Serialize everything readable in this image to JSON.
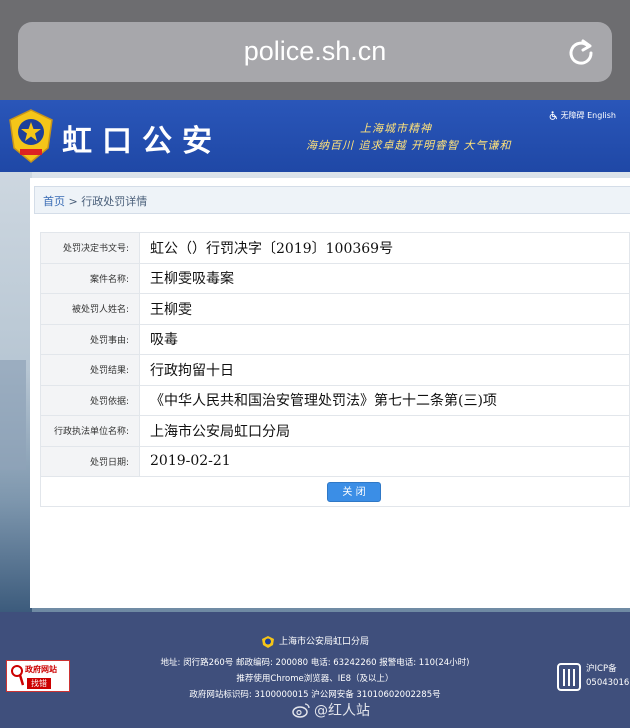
{
  "browser": {
    "url": "police.sh.cn",
    "reload_icon": "reload-icon"
  },
  "header": {
    "title": "虹口公安",
    "emblem_icon": "police-emblem-icon",
    "slogan_line1": "上海城市精神",
    "slogan_line2": "海纳百川 追求卓越 开明睿智 大气谦和",
    "accessibility_label": "无障碍 English",
    "accent_color": "#2a56b9"
  },
  "breadcrumb": {
    "home": "首页",
    "separator": " > ",
    "current": "行政处罚详情"
  },
  "detail": {
    "rows": [
      {
        "label": "处罚决定书文号:",
        "value": "虹公（）行罚决字〔2019〕100369号"
      },
      {
        "label": "案件名称:",
        "value": "王柳雯吸毒案"
      },
      {
        "label": "被处罚人姓名:",
        "value": "王柳雯"
      },
      {
        "label": "处罚事由:",
        "value": "吸毒"
      },
      {
        "label": "处罚结果:",
        "value": "行政拘留十日"
      },
      {
        "label": "处罚依据:",
        "value": "《中华人民共和国治安管理处罚法》第七十二条第(三)项"
      },
      {
        "label": "行政执法单位名称:",
        "value": "上海市公安局虹口分局"
      },
      {
        "label": "处罚日期:",
        "value": "2019-02-21"
      }
    ],
    "close_label": "关 闭"
  },
  "footer": {
    "org_name": "上海市公安局虹口分局",
    "address_line": "地址: 闵行路260号 邮政编码: 200080 电话: 63242260 报警电话: 110(24小时)",
    "browser_line": "推荐使用Chrome浏览器、IE8（及以上）",
    "site_id_line": "政府网站标识码: 3100000015   沪公网安备 31010602002285号",
    "gov_badge_top": "政府网站",
    "gov_badge_bottom": "找错",
    "icp_line1": "沪ICP备",
    "icp_line2": "05043016"
  },
  "watermark": {
    "text": "@红人站"
  }
}
